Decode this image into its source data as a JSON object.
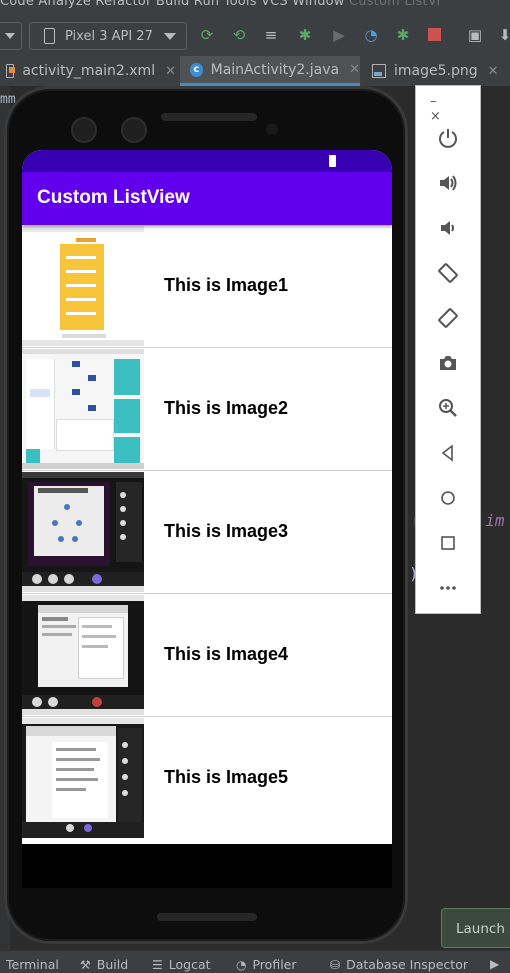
{
  "ide": {
    "menu_text": "Code   Analyze   Refactor   Build   Run   Tools   VCS   Window",
    "menu_dim_text": "Custom ListVi",
    "device_selector": "Pixel 3 API 27",
    "tabs": [
      {
        "label": "activity_main2.xml",
        "icon": "xml-file-icon"
      },
      {
        "label": "MainActivity2.java",
        "icon": "java-class-icon"
      },
      {
        "label": "image5.png",
        "icon": "png-file-icon"
      }
    ],
    "editor_fragment_left": "mm",
    "editor_fragment_right_code": "r",
    "editor_fragment_right_italic": ".im",
    "editor_fragment_brace": ")"
  },
  "emulator_panel": {
    "window_buttons": "– ×",
    "buttons": [
      "power-icon",
      "volume-up-icon",
      "volume-down-icon",
      "rotate-left-icon",
      "rotate-right-icon",
      "camera-icon",
      "zoom-icon",
      "back-icon",
      "home-icon",
      "overview-icon",
      "more-icon"
    ]
  },
  "app": {
    "title": "Custom ListView",
    "colors": {
      "primary": "#6200ee",
      "primary_dark": "#3700b3"
    },
    "items": [
      {
        "label": "This is Image1"
      },
      {
        "label": "This is Image2"
      },
      {
        "label": "This is Image3"
      },
      {
        "label": "This is Image4"
      },
      {
        "label": "This is Image5"
      }
    ]
  },
  "bottom_bar": {
    "items": [
      "Terminal",
      "Build",
      "Logcat",
      "Profiler",
      "Database Inspector"
    ]
  },
  "launch_tooltip": "Launch s"
}
